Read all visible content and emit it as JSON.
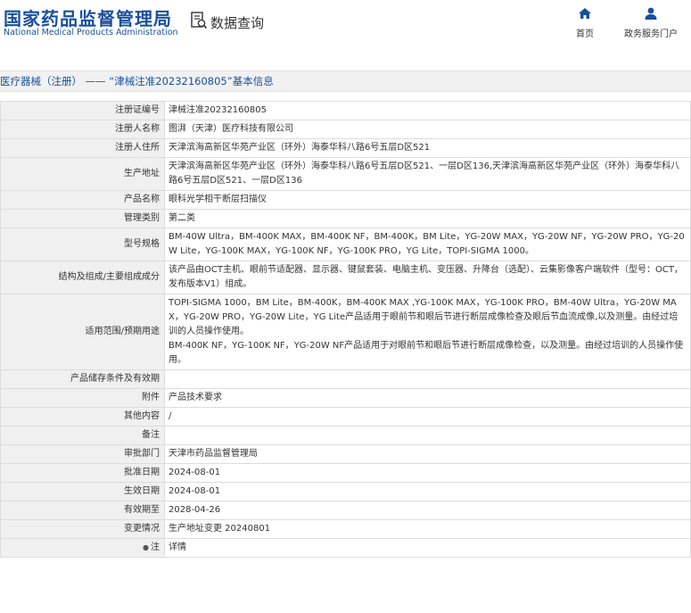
{
  "header": {
    "logo_cn": "国家药品监督管理局",
    "logo_en": "National Medical Products Administration",
    "search_label": "数据查询",
    "nav_home": "首页",
    "nav_service": "政务服务门户"
  },
  "breadcrumb": "医疗器械（注册） —— “津械注准20232160805”基本信息",
  "rows": [
    {
      "k": "注册证编号",
      "v": "津械注准20232160805"
    },
    {
      "k": "注册人名称",
      "v": "图湃（天津）医疗科技有限公司"
    },
    {
      "k": "注册人住所",
      "v": "天津滨海高新区华苑产业区（环外）海泰华科八路6号五层D区521"
    },
    {
      "k": "生产地址",
      "v": "天津滨海高新区华苑产业区（环外）海泰华科八路6号五层D区521、一层D区136,天津滨海高新区华苑产业区（环外）海泰华科八路6号五层D区521、一层D区136"
    },
    {
      "k": "产品名称",
      "v": "眼科光学相干断层扫描仪"
    },
    {
      "k": "管理类别",
      "v": "第二类"
    },
    {
      "k": "型号规格",
      "v": "BM-40W Ultra，BM-400K MAX，BM-400K NF，BM-400K，BM Lite，YG-20W MAX，YG-20W NF，YG-20W PRO，YG-20W Lite，YG-100K MAX，YG-100K NF，YG-100K PRO，YG Lite，TOPI-SIGMA 1000。"
    },
    {
      "k": "结构及组成/主要组成成分",
      "v": "该产品由OCT主机、眼前节适配器、显示器、键鼠套装、电脑主机、变压器、升降台（选配）、云集影像客户端软件（型号：OCT，发布版本V1）组成。"
    },
    {
      "k": "适用范围/预期用途",
      "v": "TOPI-SIGMA 1000，BM Lite，BM-400K，BM-400K MAX ,YG-100K MAX，YG-100K PRO，BM-40W Ultra，YG-20W MAX，YG-20W PRO，YG-20W Lite，YG Lite产品适用于眼前节和眼后节进行断层成像检查及眼后节血流成像,以及测量。由经过培训的人员操作使用。\nBM-400K NF，YG-100K NF，YG-20W NF产品适用于对眼前节和眼后节进行断层成像检查，以及测量。由经过培训的人员操作使用。"
    },
    {
      "k": "产品储存条件及有效期",
      "v": ""
    },
    {
      "k": "附件",
      "v": "产品技术要求"
    },
    {
      "k": "其他内容",
      "v": "/"
    },
    {
      "k": "备注",
      "v": ""
    },
    {
      "k": "审批部门",
      "v": "天津市药品监督管理局"
    },
    {
      "k": "批准日期",
      "v": "2024-08-01"
    },
    {
      "k": "生效日期",
      "v": "2024-08-01"
    },
    {
      "k": "有效期至",
      "v": "2028-04-26"
    },
    {
      "k": "变更情况",
      "v": "生产地址变更 20240801"
    },
    {
      "k": "注",
      "v": "详情",
      "link": true
    }
  ],
  "colors": {
    "brand": "#1a4f9c",
    "label_bg": "#f0f0f0",
    "border": "#dcdcdc"
  }
}
